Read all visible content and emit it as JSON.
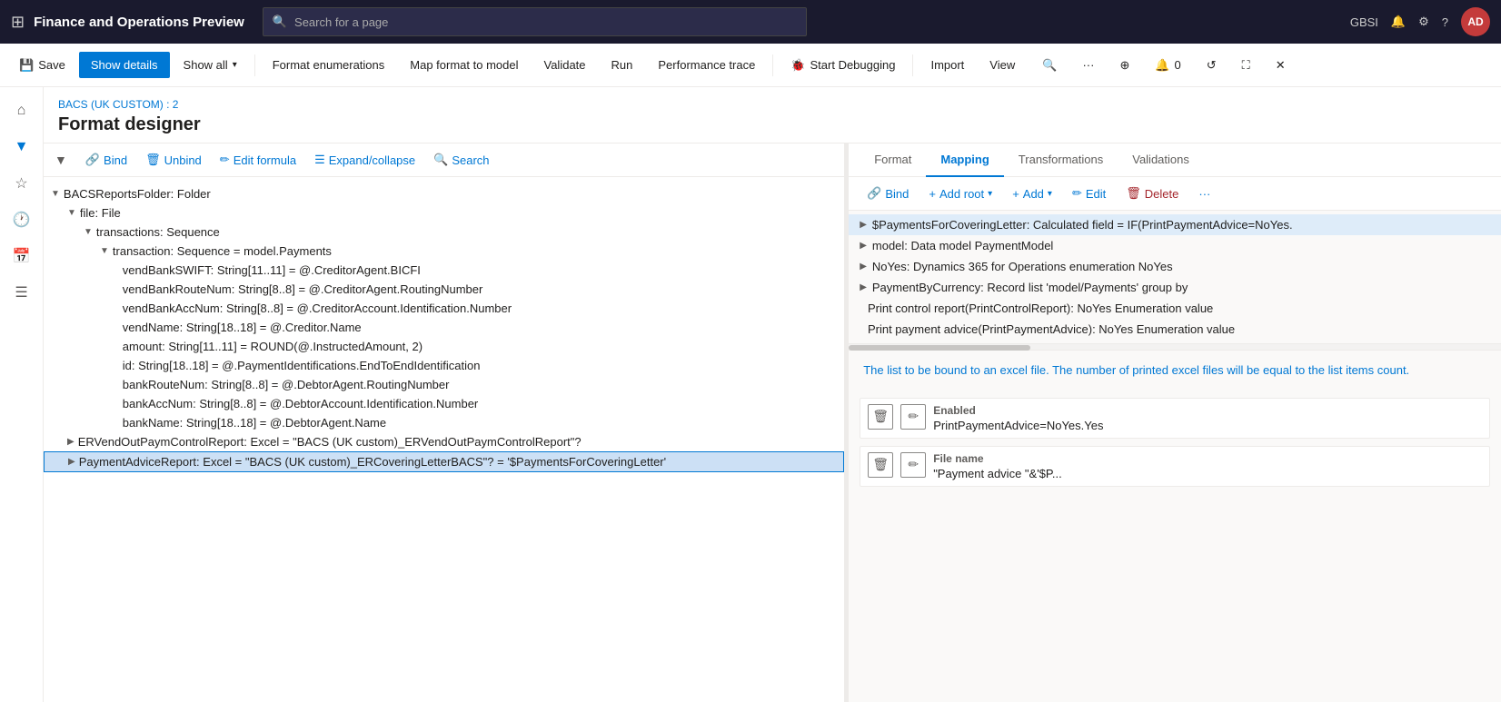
{
  "topNav": {
    "appTitle": "Finance and Operations Preview",
    "searchPlaceholder": "Search for a page",
    "userInitials": "AD",
    "userName": "GBSI",
    "badgeCount": "0"
  },
  "toolbar": {
    "saveLabel": "Save",
    "showDetailsLabel": "Show details",
    "showAllLabel": "Show all",
    "formatEnumerationsLabel": "Format enumerations",
    "mapFormatToModelLabel": "Map format to model",
    "validateLabel": "Validate",
    "runLabel": "Run",
    "performanceTraceLabel": "Performance trace",
    "startDebuggingLabel": "Start Debugging",
    "importLabel": "Import",
    "viewLabel": "View"
  },
  "breadcrumb": "BACS (UK CUSTOM) : 2",
  "pageTitle": "Format designer",
  "leftToolbar": {
    "bindLabel": "Bind",
    "unbindLabel": "Unbind",
    "editFormulaLabel": "Edit formula",
    "expandCollapseLabel": "Expand/collapse",
    "searchLabel": "Search"
  },
  "treeItems": [
    {
      "indent": 0,
      "chevron": "▼",
      "text": "BACSReportsFolder: Folder",
      "level": 0
    },
    {
      "indent": 1,
      "chevron": "▼",
      "text": "file: File",
      "level": 1
    },
    {
      "indent": 2,
      "chevron": "▼",
      "text": "transactions: Sequence",
      "level": 2
    },
    {
      "indent": 3,
      "chevron": "▼",
      "text": "transaction: Sequence = model.Payments",
      "level": 3
    },
    {
      "indent": 4,
      "chevron": "",
      "text": "vendBankSWIFT: String[11..11] = @.CreditorAgent.BICFI",
      "level": 4
    },
    {
      "indent": 4,
      "chevron": "",
      "text": "vendBankRouteNum: String[8..8] = @.CreditorAgent.RoutingNumber",
      "level": 4
    },
    {
      "indent": 4,
      "chevron": "",
      "text": "vendBankAccNum: String[8..8] = @.CreditorAccount.Identification.Number",
      "level": 4
    },
    {
      "indent": 4,
      "chevron": "",
      "text": "vendName: String[18..18] = @.Creditor.Name",
      "level": 4
    },
    {
      "indent": 4,
      "chevron": "",
      "text": "amount: String[11..11] = ROUND(@.InstructedAmount, 2)",
      "level": 4
    },
    {
      "indent": 4,
      "chevron": "",
      "text": "id: String[18..18] = @.PaymentIdentifications.EndToEndIdentification",
      "level": 4
    },
    {
      "indent": 4,
      "chevron": "",
      "text": "bankRouteNum: String[8..8] = @.DebtorAgent.RoutingNumber",
      "level": 4
    },
    {
      "indent": 4,
      "chevron": "",
      "text": "bankAccNum: String[8..8] = @.DebtorAccount.Identification.Number",
      "level": 4
    },
    {
      "indent": 4,
      "chevron": "",
      "text": "bankName: String[18..18] = @.DebtorAgent.Name",
      "level": 4
    },
    {
      "indent": 1,
      "chevron": "▶",
      "text": "ERVendOutPaymControlReport: Excel = \"BACS (UK custom)_ERVendOutPaymControlReport\"?",
      "level": 1,
      "collapsed": true
    },
    {
      "indent": 1,
      "chevron": "▶",
      "text": "PaymentAdviceReport: Excel = \"BACS (UK custom)_ERCoveringLetterBACS\"? = '$PaymentsForCoveringLetter'",
      "level": 1,
      "collapsed": true,
      "selected": true
    }
  ],
  "rightTabs": [
    {
      "label": "Format",
      "active": false
    },
    {
      "label": "Mapping",
      "active": true
    },
    {
      "label": "Transformations",
      "active": false
    },
    {
      "label": "Validations",
      "active": false
    }
  ],
  "rightToolbar": {
    "bindLabel": "Bind",
    "addRootLabel": "Add root",
    "addLabel": "Add",
    "editLabel": "Edit",
    "deleteLabel": "Delete"
  },
  "rightTreeItems": [
    {
      "indent": 0,
      "chevron": "▶",
      "text": "$PaymentsForCoveringLetter: Calculated field = IF(PrintPaymentAdvice=NoYes.",
      "selected": true
    },
    {
      "indent": 0,
      "chevron": "▶",
      "text": "model: Data model PaymentModel",
      "selected": false
    },
    {
      "indent": 0,
      "chevron": "▶",
      "text": "NoYes: Dynamics 365 for Operations enumeration NoYes",
      "selected": false
    },
    {
      "indent": 0,
      "chevron": "▶",
      "text": "PaymentByCurrency: Record list 'model/Payments' group by",
      "selected": false
    },
    {
      "indent": 0,
      "chevron": "",
      "text": "Print control report(PrintControlReport): NoYes Enumeration value",
      "selected": false
    },
    {
      "indent": 0,
      "chevron": "",
      "text": "Print payment advice(PrintPaymentAdvice): NoYes Enumeration value",
      "selected": false
    }
  ],
  "infoText": "The list to be bound to an excel file. The number of printed excel files will be equal to the list items count.",
  "properties": [
    {
      "label": "Enabled",
      "value": "PrintPaymentAdvice=NoYes.Yes"
    },
    {
      "label": "File name",
      "value": "\"Payment advice \"&'$P..."
    }
  ]
}
